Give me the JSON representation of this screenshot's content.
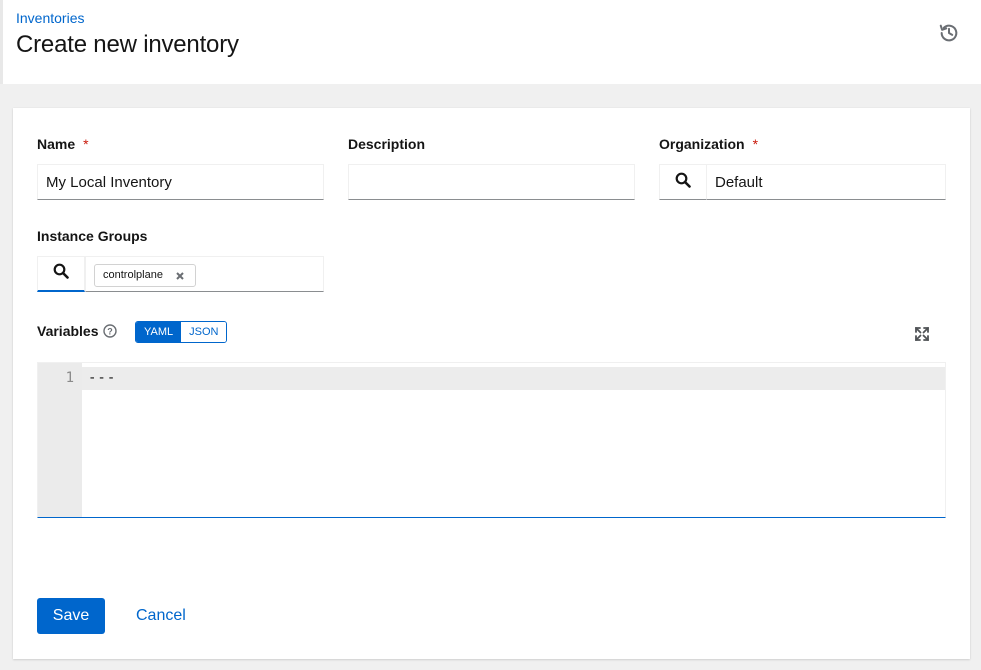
{
  "header": {
    "breadcrumb": "Inventories",
    "title": "Create new inventory",
    "history_icon": "history-icon"
  },
  "form": {
    "name": {
      "label": "Name",
      "required_mark": "*",
      "value": "My Local Inventory"
    },
    "description": {
      "label": "Description",
      "value": ""
    },
    "organization": {
      "label": "Organization",
      "required_mark": "*",
      "value": "Default",
      "icon": "search-icon"
    },
    "instance_groups": {
      "label": "Instance Groups",
      "chips": [
        "controlplane"
      ],
      "icon": "search-icon"
    },
    "variables": {
      "label": "Variables",
      "help_icon": "help-icon",
      "toggle": {
        "options": [
          "YAML",
          "JSON"
        ],
        "selected": "YAML"
      },
      "expand_icon": "expand-icon",
      "editor": {
        "line_numbers": [
          "1"
        ],
        "lines": [
          "---"
        ]
      }
    }
  },
  "actions": {
    "save_label": "Save",
    "cancel_label": "Cancel"
  },
  "colors": {
    "primary": "#0066cc",
    "required": "#c9190b",
    "text": "#151515"
  }
}
